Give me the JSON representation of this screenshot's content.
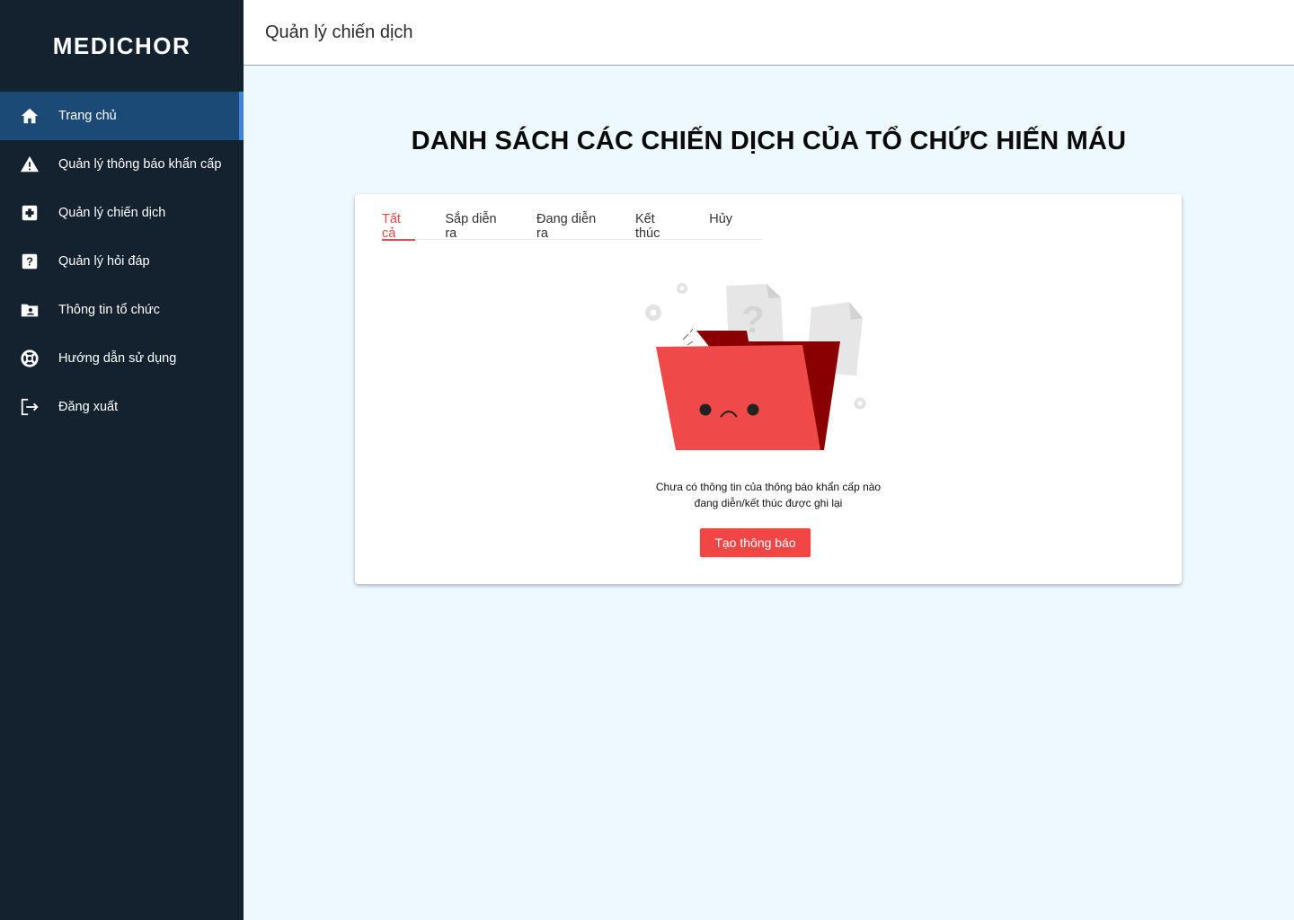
{
  "app": {
    "logo": "MEDICHOR"
  },
  "sidebar": {
    "items": [
      {
        "label": "Trang chủ",
        "icon": "home-icon",
        "active": true
      },
      {
        "label": "Quản lý thông báo khẩn cấp",
        "icon": "warning-icon"
      },
      {
        "label": "Quản lý chiến dịch",
        "icon": "medical-plus-icon"
      },
      {
        "label": "Quản lý hỏi đáp",
        "icon": "question-icon"
      },
      {
        "label": "Thông tin tổ chức",
        "icon": "folder-user-icon"
      },
      {
        "label": "Hướng dẫn sử dụng",
        "icon": "lifebuoy-icon"
      },
      {
        "label": "Đăng xuất",
        "icon": "logout-icon"
      }
    ]
  },
  "header": {
    "title": "Quản lý chiến dịch"
  },
  "main": {
    "title": "DANH SÁCH CÁC CHIẾN DỊCH CỦA TỔ CHỨC HIẾN MÁU",
    "tabs": [
      {
        "label": "Tất cả",
        "active": true
      },
      {
        "label": "Sắp diễn ra"
      },
      {
        "label": "Đang diễn ra"
      },
      {
        "label": "Kết thúc"
      },
      {
        "label": "Hủy"
      }
    ],
    "empty": {
      "line1": "Chưa có thông tin của thông báo khẩn cấp nào",
      "line2": "đang diễn/kết thúc được ghi lại",
      "illustration": "sad-folder-illustration",
      "button": "Tạo thông báo"
    }
  },
  "colors": {
    "sidebar": "#14222f",
    "sidebar_active": "#1c4a77",
    "accent": "#f04646",
    "background": "#edf9fe"
  }
}
